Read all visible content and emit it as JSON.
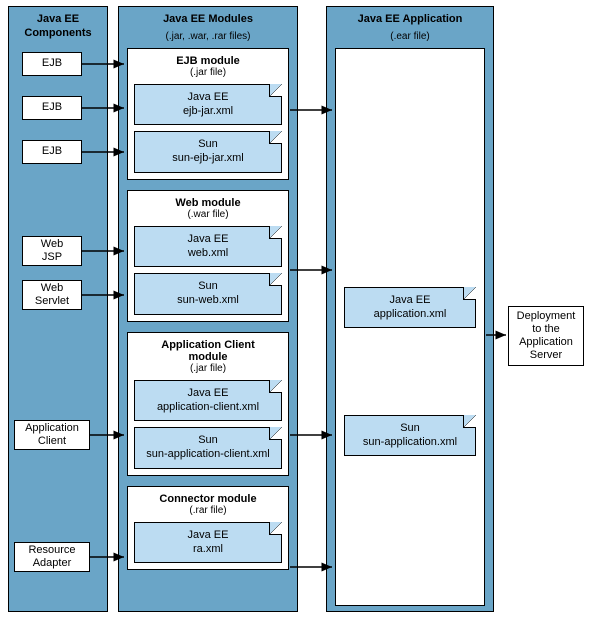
{
  "columns": {
    "components": {
      "title": "Java EE\nComponents"
    },
    "modules": {
      "title": "Java EE Modules",
      "sub": "(.jar, .war, .rar files)"
    },
    "application": {
      "title": "Java EE Application",
      "sub": "(.ear file)"
    }
  },
  "components": {
    "ejb1": "EJB",
    "ejb2": "EJB",
    "ejb3": "EJB",
    "webjsp": "Web\nJSP",
    "webservlet": "Web\nServlet",
    "appclient": "Application\nClient",
    "resource": "Resource\nAdapter"
  },
  "modules": {
    "ejb": {
      "title": "EJB module",
      "sub": "(.jar file)",
      "dd1": {
        "top": "Java EE",
        "bottom": "ejb-jar.xml"
      },
      "dd2": {
        "top": "Sun",
        "bottom": "sun-ejb-jar.xml"
      }
    },
    "web": {
      "title": "Web module",
      "sub": "(.war file)",
      "dd1": {
        "top": "Java EE",
        "bottom": "web.xml"
      },
      "dd2": {
        "top": "Sun",
        "bottom": "sun-web.xml"
      }
    },
    "appclient": {
      "title": "Application Client\nmodule",
      "sub": "(.jar file)",
      "dd1": {
        "top": "Java EE",
        "bottom": "application-client.xml"
      },
      "dd2": {
        "top": "Sun",
        "bottom": "sun-application-client.xml"
      }
    },
    "connector": {
      "title": "Connector module",
      "sub": "(.rar file)",
      "dd1": {
        "top": "Java EE",
        "bottom": "ra.xml"
      }
    }
  },
  "application": {
    "dd1": {
      "top": "Java EE",
      "bottom": "application.xml"
    },
    "dd2": {
      "top": "Sun",
      "bottom": "sun-application.xml"
    }
  },
  "deployment": "Deployment\nto the\nApplication\nServer"
}
